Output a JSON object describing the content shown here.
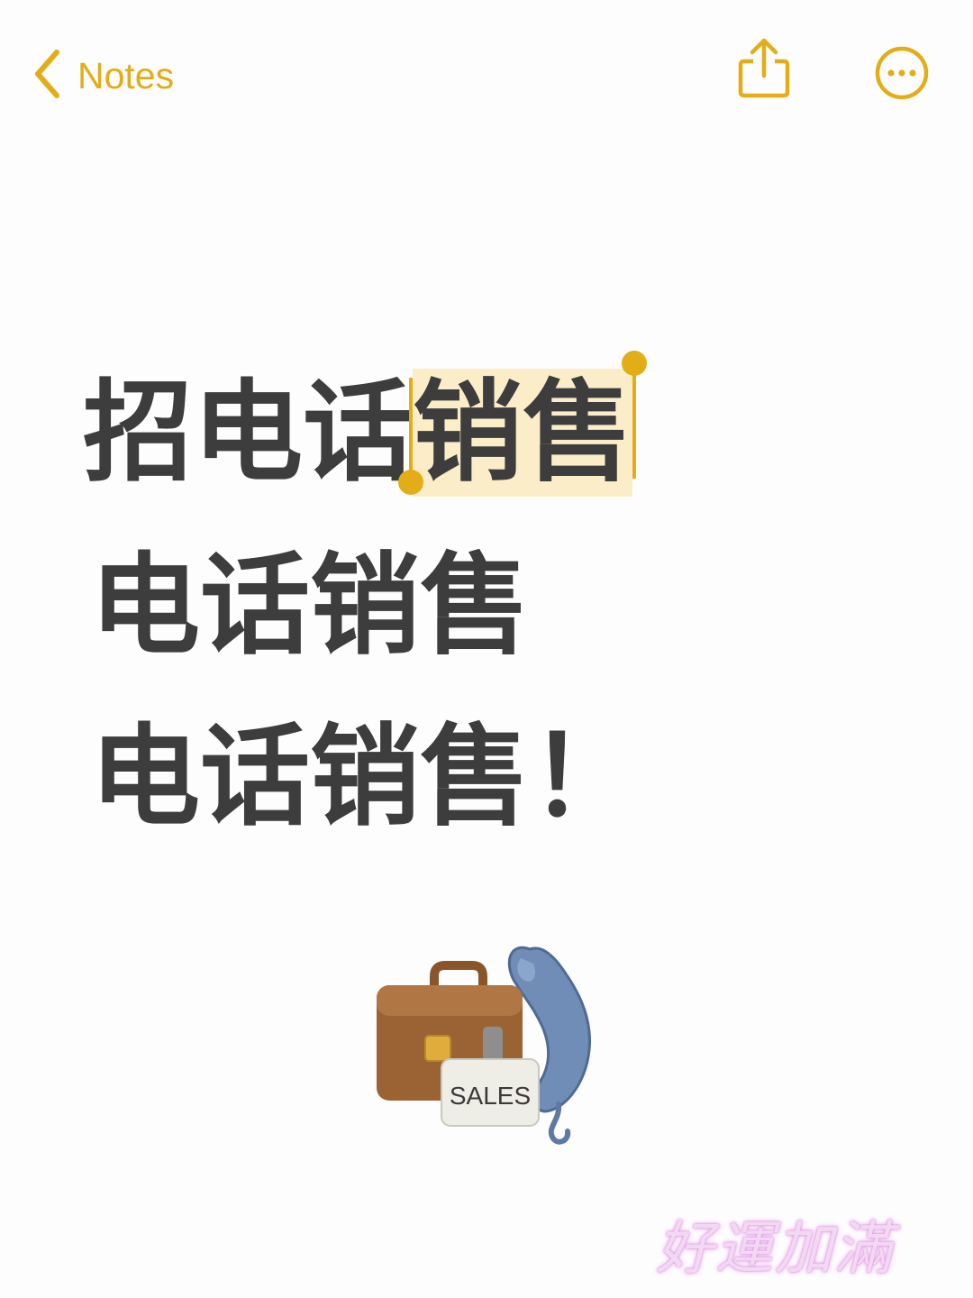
{
  "nav": {
    "back_label": "Notes",
    "accent_color": "#e3ad18",
    "icons": [
      "chevron-left-icon",
      "share-icon",
      "more-icon"
    ]
  },
  "note": {
    "line1_prefix": "招电话",
    "line1_selected": "销售",
    "line2": "电话销售",
    "line3": "电话销售！",
    "selection_color": "#fbedc7"
  },
  "illustration": {
    "sign_text": "SALES",
    "icons": [
      "briefcase-icon",
      "telephone-handset-icon",
      "sales-sign-icon"
    ]
  },
  "watermark": {
    "text": "好運加滿"
  }
}
